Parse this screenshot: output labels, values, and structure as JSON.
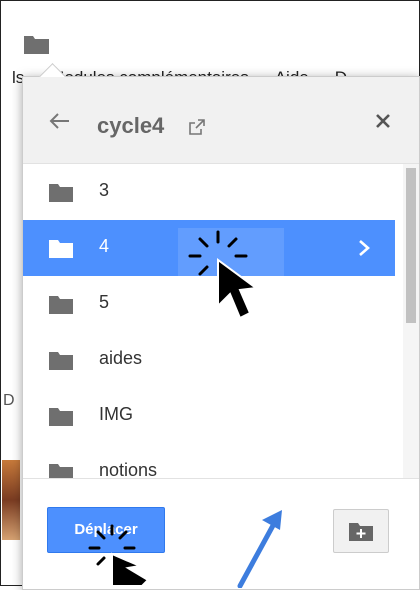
{
  "background": {
    "menubar": [
      {
        "label": "ls"
      },
      {
        "label": "Modules complémentaires"
      },
      {
        "label": "Aide"
      },
      {
        "label": "D"
      }
    ],
    "left_letter": "D"
  },
  "dialog": {
    "title": "cycle4",
    "icons": {
      "back": "arrow-left-icon",
      "open_external": "external-link-icon",
      "close": "close-icon"
    },
    "folders": [
      {
        "label": "3",
        "selected": false
      },
      {
        "label": "4",
        "selected": true
      },
      {
        "label": "5",
        "selected": false
      },
      {
        "label": "aides",
        "selected": false
      },
      {
        "label": "IMG",
        "selected": false
      },
      {
        "label": "notions",
        "selected": false
      }
    ],
    "move_button": "Déplacer",
    "new_folder_icon": "new-folder-icon"
  },
  "colors": {
    "selection": "#4d90fe",
    "header_bg": "#f1f1f1",
    "folder_icon": "#6f6f6f",
    "annotation_arrow": "#3d7dde"
  }
}
